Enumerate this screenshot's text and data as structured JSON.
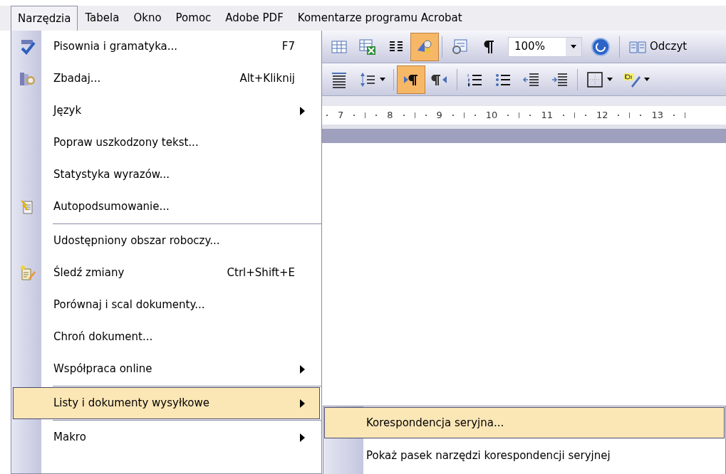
{
  "menu_bar": [
    {
      "label": "Narzędzia",
      "selected": true
    },
    {
      "label": "Tabela",
      "selected": false
    },
    {
      "label": "Okno",
      "selected": false
    },
    {
      "label": "Pomoc",
      "selected": false
    },
    {
      "label": "Adobe PDF",
      "selected": false
    },
    {
      "label": "Komentarze programu Acrobat",
      "selected": false
    }
  ],
  "menu": [
    {
      "kind": "spelling",
      "label": "Pisownia i gramatyka...",
      "shortcut": "F7",
      "submenu": false,
      "selected": false,
      "separator_before": false
    },
    {
      "kind": "research",
      "label": "Zbadaj...",
      "shortcut": "Alt+Kliknij",
      "submenu": false,
      "selected": false,
      "separator_before": false
    },
    {
      "kind": "plain",
      "label": "Język",
      "submenu": true,
      "selected": false,
      "separator_before": false
    },
    {
      "kind": "plain",
      "label": "Popraw uszkodzony tekst...",
      "submenu": false,
      "selected": false,
      "separator_before": false
    },
    {
      "kind": "plain",
      "label": "Statystyka wyrazów...",
      "submenu": false,
      "selected": false,
      "separator_before": false
    },
    {
      "kind": "summary",
      "label": "Autopodsumowanie...",
      "submenu": false,
      "selected": false,
      "separator_before": false
    },
    {
      "kind": "plain",
      "label": "Udostępniony obszar roboczy...",
      "submenu": false,
      "selected": false,
      "separator_before": true
    },
    {
      "kind": "track",
      "label": "Śledź zmiany",
      "shortcut": "Ctrl+Shift+E",
      "submenu": false,
      "selected": false,
      "separator_before": false
    },
    {
      "kind": "plain",
      "label": "Porównaj i scal dokumenty...",
      "submenu": false,
      "selected": false,
      "separator_before": false
    },
    {
      "kind": "plain",
      "label": "Chroń dokument...",
      "submenu": false,
      "selected": false,
      "separator_before": false
    },
    {
      "kind": "plain",
      "label": "Współpraca online",
      "submenu": true,
      "selected": false,
      "separator_before": false
    },
    {
      "kind": "plain",
      "label": "Listy i dokumenty wysyłkowe",
      "submenu": true,
      "selected": true,
      "separator_before": true
    },
    {
      "kind": "plain",
      "label": "Makro",
      "submenu": true,
      "selected": false,
      "separator_before": true
    }
  ],
  "submenu": [
    {
      "label": "Korespondencja seryjna...",
      "selected": true
    },
    {
      "label": "Pokaż pasek narzędzi korespondencji seryjnej",
      "selected": false
    }
  ],
  "toolbar_1": [
    {
      "kind": "table",
      "pressed": false
    },
    {
      "kind": "excel",
      "pressed": false
    },
    {
      "kind": "columns",
      "pressed": false
    },
    {
      "kind": "drawing",
      "pressed": true
    },
    {
      "kind": "separator"
    },
    {
      "kind": "map",
      "pressed": false
    },
    {
      "kind": "pilcrow",
      "pressed": false
    }
  ],
  "zoom": {
    "value": "100%"
  },
  "reading_button": {
    "label": "Odczyt"
  },
  "toolbar_2": [
    {
      "kind": "width",
      "pressed": false
    },
    {
      "kind": "spacing",
      "pressed": false
    },
    {
      "kind": "separator"
    },
    {
      "kind": "ltr",
      "pressed": true
    },
    {
      "kind": "rtl",
      "pressed": false
    },
    {
      "kind": "separator"
    },
    {
      "kind": "numbering",
      "pressed": false
    },
    {
      "kind": "bullets",
      "pressed": false
    },
    {
      "kind": "outdent",
      "pressed": false
    },
    {
      "kind": "indent",
      "pressed": false
    },
    {
      "kind": "separator"
    },
    {
      "kind": "border",
      "pressed": false
    },
    {
      "kind": "highlight",
      "pressed": false
    }
  ],
  "ruler": [
    "7",
    "8",
    "9",
    "10",
    "11",
    "12",
    "13"
  ]
}
